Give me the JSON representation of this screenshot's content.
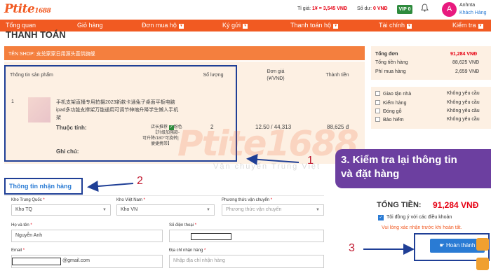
{
  "brand": {
    "logo": "Ptite",
    "logo_num": "1688"
  },
  "header": {
    "rate_label": "Tỉ giá:",
    "rate_value": "1¥ = 3,545 VNĐ",
    "balance_label": "Số dư:",
    "balance_value": "0 VNĐ",
    "vip": "VIP 0",
    "avatar_letter": "A",
    "user_name": "Anhnta",
    "user_role": "Khách Hàng"
  },
  "nav": {
    "items": [
      {
        "label": "Tổng quan",
        "caret": false
      },
      {
        "label": "Giỏ hàng",
        "caret": false
      },
      {
        "label": "Đơn mua hộ",
        "caret": true
      },
      {
        "label": "Ký gửi",
        "caret": true
      },
      {
        "label": "Thanh toán hộ",
        "caret": true
      },
      {
        "label": "Tài chính",
        "caret": true
      },
      {
        "label": "Kiểm tra",
        "caret": true
      }
    ]
  },
  "page_title": "THANH TOÁN",
  "shop": {
    "label": "TÊN SHOP: 支兑家家日用源头直供旗舰"
  },
  "order": {
    "headers": {
      "product": "Thông tin sản phẩm",
      "qty": "Số lượng",
      "price": "Đơn giá\n(¥/VNĐ)",
      "total": "Thành tiền"
    },
    "row": {
      "index": "1",
      "name_l1": "手机支架直播专用拍摄2023新款卡通兔子桌面平板电脑",
      "name_l2": "ipad多功能支撑架万能通用可调节伸缩升降学生懒人手机",
      "name_l3": "架",
      "attr_label": "Thuộc tính:",
      "attr_l1": "店长推荐",
      "attr_l1b": "粉色",
      "attr_l2": "【升级加强款-",
      "attr_l3": "可升降/180°可旋转|",
      "attr_l4": "便捷携带】",
      "attr_x": "↓",
      "note_label": "Ghi chú:",
      "qty": "2",
      "price": "12.50 / 44,313",
      "total": "88,625 đ"
    }
  },
  "summary": {
    "rows": [
      {
        "label": "Tổng đơn",
        "value": "91,284 VNĐ"
      },
      {
        "label": "Tổng tiền hàng",
        "value": "88,625 VNĐ"
      },
      {
        "label": "Phí mua hàng",
        "value": "2,659 VNĐ"
      }
    ]
  },
  "services": [
    {
      "label": "Giao tận nhà",
      "value": "Không yêu cầu"
    },
    {
      "label": "Kiểm hàng",
      "value": "Không yêu cầu"
    },
    {
      "label": "Đóng gỗ",
      "value": "Không yêu cầu"
    },
    {
      "label": "Bảo hiểm",
      "value": "Không yêu cầu"
    }
  ],
  "watermark": {
    "main": "Ptite1688",
    "sub": "Vận chuyển Trung Việt"
  },
  "callout": {
    "line1": "3. Kiểm tra lại thông tin",
    "line2": "và đặt hàng"
  },
  "annotations": {
    "one": "1",
    "two": "2",
    "three": "3"
  },
  "receiver": {
    "title": "Thông tin nhận hàng",
    "fields": {
      "kho_tq_label": "Kho Trung Quốc",
      "kho_tq_value": "Kho TQ",
      "kho_vn_label": "Kho Việt Nam",
      "kho_vn_value": "Kho VN",
      "shipping_label": "Phương thức vận chuyển",
      "shipping_placeholder": "Phương thức vận chuyển",
      "name_label": "Họ và tên",
      "name_value": "Nguyễn Anh",
      "phone_label": "Số điện thoại",
      "email_label": "Email",
      "email_suffix": "@gmail.com",
      "address_label": "Địa chỉ nhận hàng",
      "address_placeholder": "Nhập địa chỉ nhận hàng"
    },
    "required_mark": "*"
  },
  "checkout": {
    "total_label": "TỔNG TIỀN:",
    "total_value": "91,284 VNĐ",
    "agree_label": "Tôi đồng ý với các điều khoản",
    "warning": "Vui lòng xác nhận trước khi hoàn tất.",
    "finish_button": "Hoàn thành"
  },
  "colors": {
    "brand": "#f15a22",
    "highlight": "#1f3f96",
    "callout": "#6c3fa0",
    "price": "#e60012",
    "link": "#2a7bd4"
  }
}
